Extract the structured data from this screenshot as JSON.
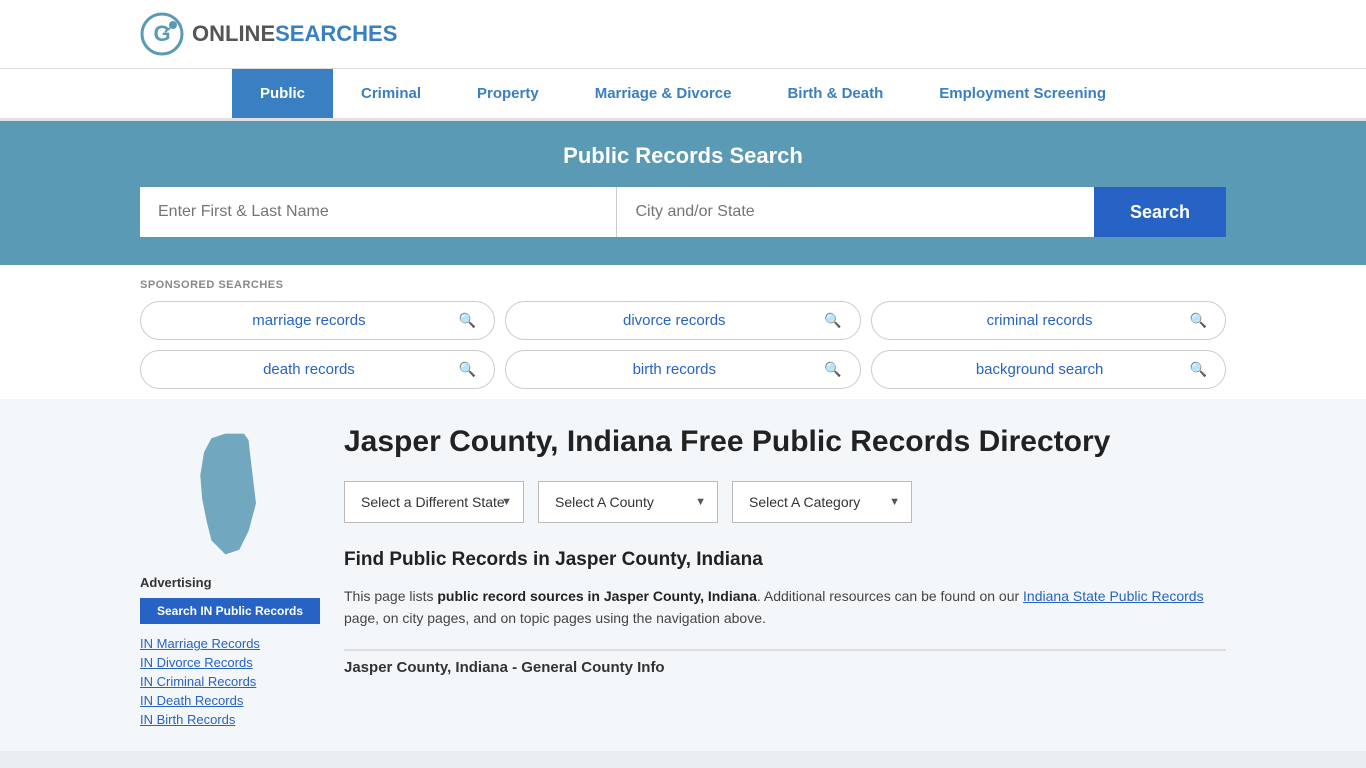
{
  "header": {
    "logo_online": "ONLINE",
    "logo_searches": "SEARCHES"
  },
  "nav": {
    "items": [
      {
        "label": "Public",
        "active": true
      },
      {
        "label": "Criminal",
        "active": false
      },
      {
        "label": "Property",
        "active": false
      },
      {
        "label": "Marriage & Divorce",
        "active": false
      },
      {
        "label": "Birth & Death",
        "active": false
      },
      {
        "label": "Employment Screening",
        "active": false
      }
    ]
  },
  "hero": {
    "title": "Public Records Search",
    "name_placeholder": "Enter First & Last Name",
    "location_placeholder": "City and/or State",
    "search_button": "Search"
  },
  "sponsored": {
    "label": "SPONSORED SEARCHES",
    "items": [
      "marriage records",
      "divorce records",
      "criminal records",
      "death records",
      "birth records",
      "background search"
    ]
  },
  "page": {
    "title": "Jasper County, Indiana Free Public Records Directory",
    "select_state": "Select a Different State",
    "select_county": "Select A County",
    "select_category": "Select A Category",
    "find_title": "Find Public Records in Jasper County, Indiana",
    "desc_intro": "This page lists ",
    "desc_bold": "public record sources in Jasper County, Indiana",
    "desc_mid": ". Additional resources can be found on our ",
    "desc_link": "Indiana State Public Records",
    "desc_end": " page, on city pages, and on topic pages using the navigation above.",
    "section_heading": "Jasper County, Indiana - General County Info"
  },
  "sidebar": {
    "ad_label": "Advertising",
    "ad_button": "Search IN Public Records",
    "links": [
      "IN Marriage Records",
      "IN Divorce Records",
      "IN Criminal Records",
      "IN Death Records",
      "IN Birth Records"
    ]
  }
}
